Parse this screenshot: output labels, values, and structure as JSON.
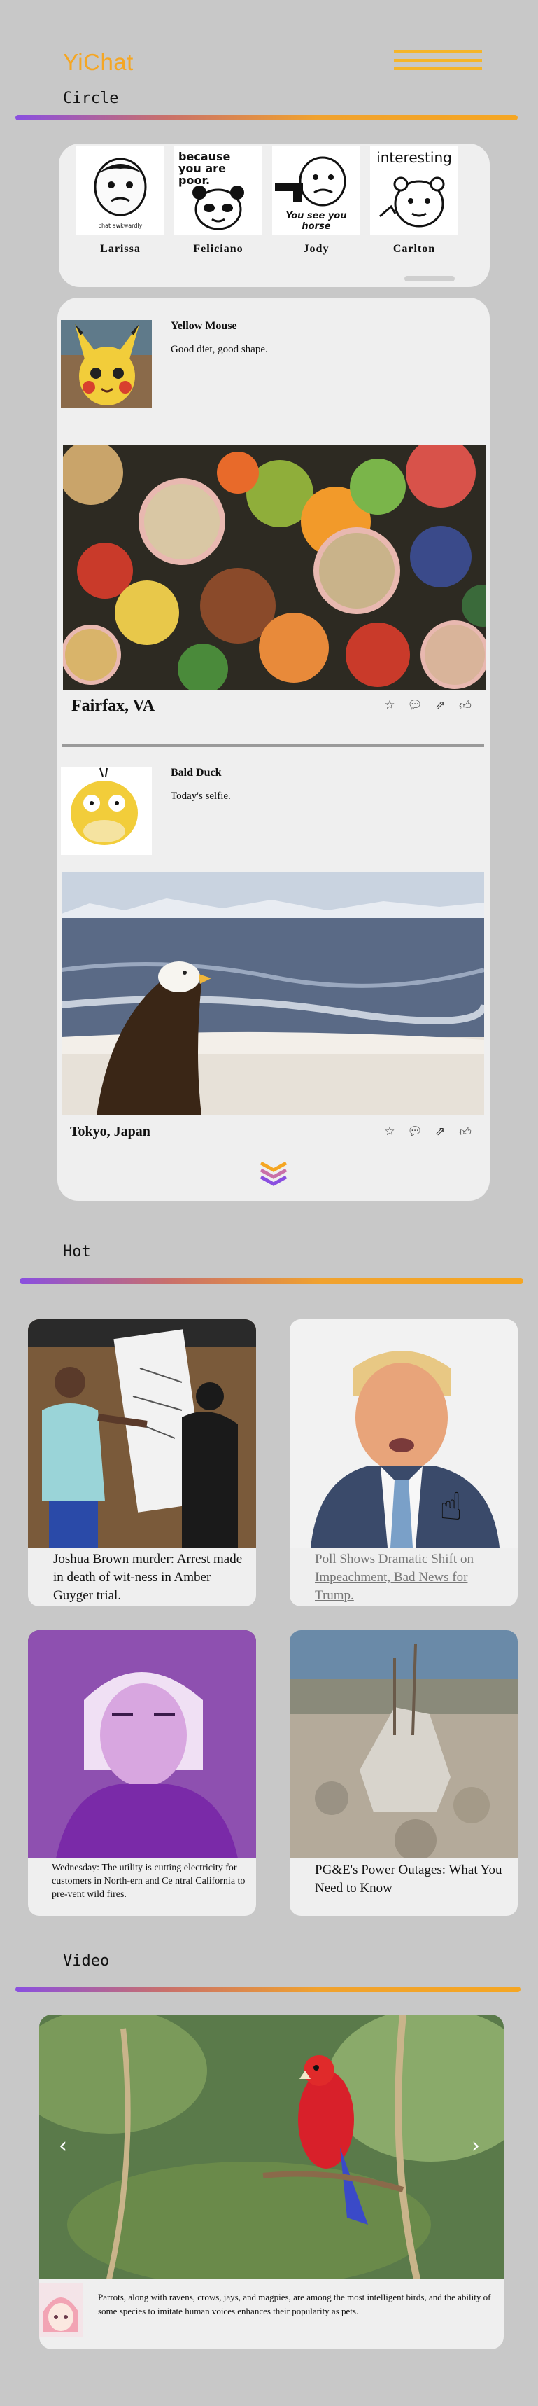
{
  "app": {
    "logo": "YiChat"
  },
  "circle": {
    "title": "Circle",
    "stories": [
      {
        "name": "Larissa",
        "caption": "chat awkwardly"
      },
      {
        "name": "Feliciano",
        "caption": "because you are poor."
      },
      {
        "name": "Jody",
        "caption": "You see you horse"
      },
      {
        "name": "Carlton",
        "caption": "interesting"
      }
    ],
    "posts": [
      {
        "user": "Yellow Mouse",
        "text": "Good diet, good shape.",
        "location": "Fairfax, VA"
      },
      {
        "user": "Bald Duck",
        "text": "Today's selfie.",
        "location": "Tokyo, Japan"
      }
    ]
  },
  "hot": {
    "title": "Hot",
    "items": [
      {
        "caption": "Joshua Brown murder: Arrest made in death of wit-ness in Amber Guyger trial."
      },
      {
        "caption": "Poll Shows Dramatic Shift on Impeachment, Bad News for Trump."
      },
      {
        "caption": "Wednesday: The utility is cutting electricity for customers in North-ern and Ce ntral California to pre-vent wild fires."
      },
      {
        "caption": "PG&E's Power Outages: What You Need to Know"
      }
    ]
  },
  "video": {
    "title": "Video",
    "description": "Parrots, along with ravens, crows, jays, and magpies, are among the most intelligent birds, and the ability of some species to imitate human voices enhances their popularity as pets."
  },
  "colors": {
    "brand": "#f5a623",
    "accent": "#8a4fe0",
    "background": "#c8c8c8",
    "card": "#efefef"
  },
  "icons": [
    "menu-icon",
    "star-icon",
    "comment-icon",
    "share-icon",
    "like-icon",
    "expand-more-icon",
    "prev-arrow-icon",
    "next-arrow-icon",
    "hand-cursor-icon"
  ]
}
